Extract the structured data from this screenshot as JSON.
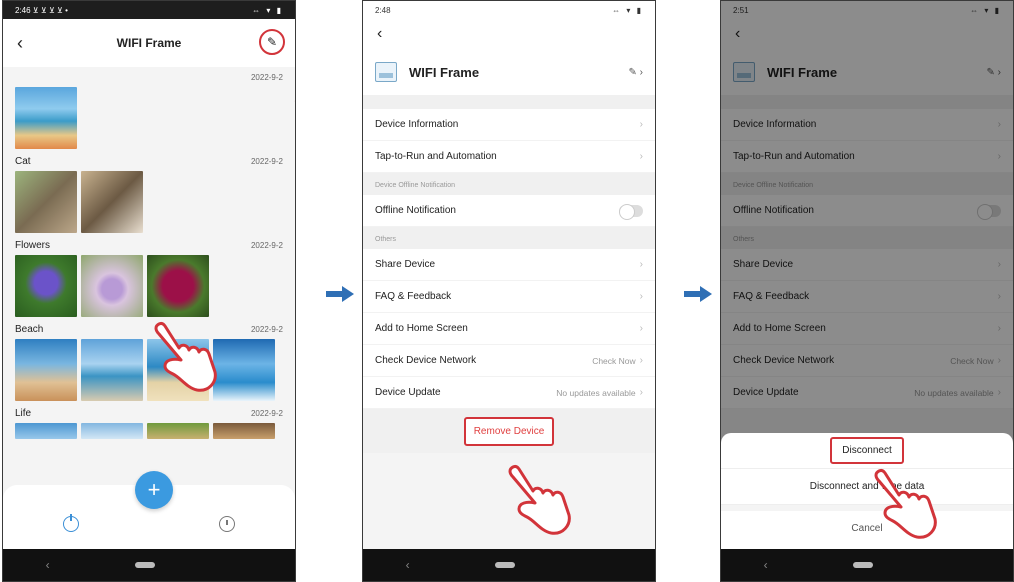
{
  "phone1": {
    "status_time": "2:46 ⊻ ⊻ ⊻ ⊻ •",
    "status_icons": "⇔ ▾ ▮",
    "title": "WIFI Frame",
    "back_glyph": "‹",
    "edit_glyph": "✎",
    "albums": [
      {
        "name": "",
        "date": "2022-9-2"
      },
      {
        "name": "Cat",
        "date": "2022-9-2"
      },
      {
        "name": "Flowers",
        "date": "2022-9-2"
      },
      {
        "name": "Beach",
        "date": "2022-9-2"
      },
      {
        "name": "Life",
        "date": "2022-9-2"
      }
    ],
    "fab_glyph": "+",
    "nav_back": "‹"
  },
  "phone2": {
    "status_time": "2:48",
    "status_icons": "⇔ ▾ ▮",
    "back_glyph": "‹",
    "device_name": "WIFI Frame",
    "rows_top": [
      {
        "label": "Device Information"
      },
      {
        "label": "Tap-to-Run and Automation"
      }
    ],
    "offline_caption": "Device Offline Notification",
    "offline_label": "Offline Notification",
    "others_caption": "Others",
    "rows_others": [
      {
        "label": "Share Device",
        "value": ""
      },
      {
        "label": "FAQ & Feedback",
        "value": ""
      },
      {
        "label": "Add to Home Screen",
        "value": ""
      },
      {
        "label": "Check Device Network",
        "value": "Check Now"
      },
      {
        "label": "Device Update",
        "value": "No updates available"
      }
    ],
    "remove_label": "Remove Device",
    "nav_back": "‹"
  },
  "phone3": {
    "status_time": "2:51",
    "status_icons": "⇔ ▾ ▮",
    "back_glyph": "‹",
    "device_name": "WIFI Frame",
    "rows_top": [
      {
        "label": "Device Information"
      },
      {
        "label": "Tap-to-Run and Automation"
      }
    ],
    "offline_caption": "Device Offline Notification",
    "offline_label": "Offline Notification",
    "others_caption": "Others",
    "rows_others": [
      {
        "label": "Share Device",
        "value": ""
      },
      {
        "label": "FAQ & Feedback",
        "value": ""
      },
      {
        "label": "Add to Home Screen",
        "value": ""
      },
      {
        "label": "Check Device Network",
        "value": "Check Now"
      },
      {
        "label": "Device Update",
        "value": "No updates available"
      }
    ],
    "sheet": {
      "disconnect": "Disconnect",
      "disconnect_wipe": "Disconnect and wipe data",
      "cancel": "Cancel"
    },
    "nav_back": "‹"
  },
  "chevron_glyph": "›",
  "colors": {
    "highlight": "#d2343a",
    "arrow": "#2f6fb5",
    "accent": "#3b9ae0"
  }
}
